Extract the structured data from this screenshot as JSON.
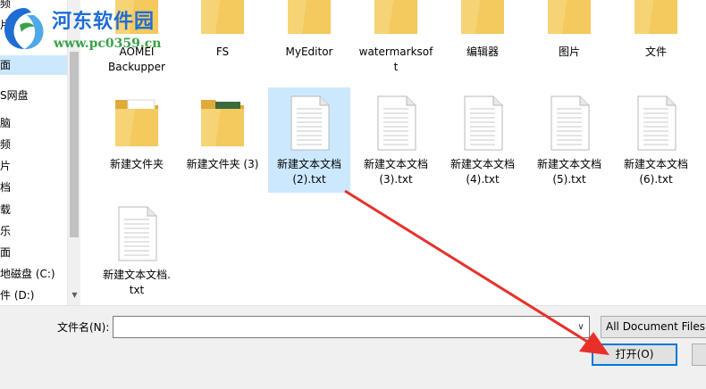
{
  "sidebar": {
    "items": [
      "频",
      "片",
      "面",
      "S网盘",
      "脑",
      "频",
      "片",
      "档",
      "载",
      "乐",
      "面",
      "地磁盘 (C:)",
      "件 (D:)"
    ]
  },
  "files": [
    {
      "label": "AOMEI\nBackupper",
      "icon": "folder-icon"
    },
    {
      "label": "FS",
      "icon": "folder-icon"
    },
    {
      "label": "MyEditor",
      "icon": "folder-icon"
    },
    {
      "label": "watermarksof\nt",
      "icon": "folder-icon"
    },
    {
      "label": "编辑器",
      "icon": "folder-icon"
    },
    {
      "label": "图片",
      "icon": "folder-icon"
    },
    {
      "label": "文件",
      "icon": "folder-icon"
    },
    {
      "label": "新建文件夹",
      "icon": "folder-icon"
    },
    {
      "label": "新建文件夹 (3)",
      "icon": "folder-icon"
    },
    {
      "label": "新建文本文档\n(2).txt",
      "icon": "text-file-icon"
    },
    {
      "label": "新建文本文档\n(3).txt",
      "icon": "text-file-icon"
    },
    {
      "label": "新建文本文档\n(4).txt",
      "icon": "text-file-icon"
    },
    {
      "label": "新建文本文档\n(5).txt",
      "icon": "text-file-icon"
    },
    {
      "label": "新建文本文档\n(6).txt",
      "icon": "text-file-icon"
    },
    {
      "label": "新建文本文档.\ntxt",
      "icon": "text-file-icon"
    }
  ],
  "selected_file_index": 9,
  "watermark": {
    "title": "河东软件园",
    "url": "www.pc0359.cn"
  },
  "bottom": {
    "filename_label": "文件名(N):",
    "filename_value": "",
    "filetype": "All Document Files (",
    "open_label": "打开(O)"
  },
  "colors": {
    "selection": "#cce8ff",
    "accent": "#0078d7",
    "arrow": "#e8302a",
    "folder": "#f4c95d",
    "watermark_blue": "#1f6dd4",
    "watermark_green": "#37a348"
  }
}
